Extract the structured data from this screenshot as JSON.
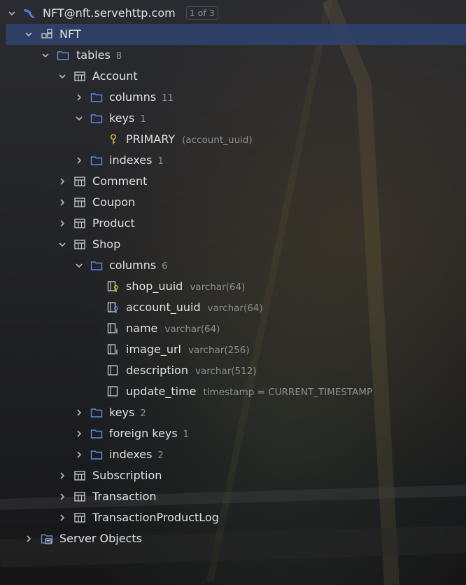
{
  "connection": {
    "name": "NFT@nft.servehttp.com",
    "badge": "1 of 3"
  },
  "schema": {
    "name": "NFT"
  },
  "tables_folder": {
    "label": "tables",
    "count": "8"
  },
  "account": {
    "name": "Account",
    "columns": {
      "label": "columns",
      "count": "11"
    },
    "keys": {
      "label": "keys",
      "count": "1"
    },
    "primary": {
      "name": "PRIMARY",
      "detail": "(account_uuid)"
    },
    "indexes": {
      "label": "indexes",
      "count": "1"
    }
  },
  "tables_collapsed_1": [
    "Comment",
    "Coupon",
    "Product"
  ],
  "shop": {
    "name": "Shop",
    "columns": {
      "label": "columns",
      "count": "6"
    },
    "column_items": [
      {
        "name": "shop_uuid",
        "type": "varchar(64)"
      },
      {
        "name": "account_uuid",
        "type": "varchar(64)"
      },
      {
        "name": "name",
        "type": "varchar(64)"
      },
      {
        "name": "image_url",
        "type": "varchar(256)"
      },
      {
        "name": "description",
        "type": "varchar(512)"
      },
      {
        "name": "update_time",
        "type": "timestamp = CURRENT_TIMESTAMP"
      }
    ],
    "keys": {
      "label": "keys",
      "count": "2"
    },
    "foreign_keys": {
      "label": "foreign keys",
      "count": "1"
    },
    "indexes": {
      "label": "indexes",
      "count": "2"
    }
  },
  "tables_collapsed_2": [
    "Subscription",
    "Transaction",
    "TransactionProductLog"
  ],
  "server_objects": {
    "label": "Server Objects"
  },
  "colors": {
    "selection": "#2e436e",
    "folder": "#5a8be8",
    "key": "#e0b23c",
    "text": "#dfe1e5",
    "muted": "#8c8f96"
  }
}
